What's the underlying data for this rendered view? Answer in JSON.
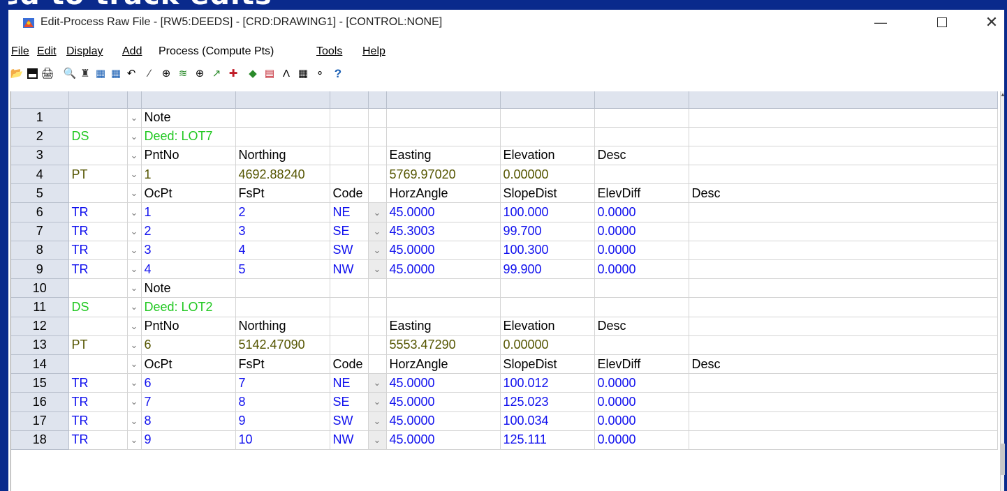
{
  "window": {
    "title": "Edit-Process Raw File - [RW5:DEEDS] - [CRD:DRAWING1] - [CONTROL:NONE]",
    "background_partial_text": "ed to track edits"
  },
  "menu": {
    "file": "File",
    "edit": "Edit",
    "display": "Display",
    "add": "Add",
    "process": "Process (Compute Pts)",
    "tools": "Tools",
    "help": "Help"
  },
  "toolbar": {
    "icons": [
      "open-icon",
      "save-icon",
      "print-icon",
      "find-icon",
      "find-replace-icon",
      "insert-record-icon",
      "delete-record-icon",
      "undo-icon",
      "traverse-icon",
      "zoom-icon",
      "sideshot-icon",
      "locate-icon",
      "pick-icon",
      "point-icon",
      "survey-icon",
      "graph-icon",
      "traverse-adjust-icon",
      "settings-icon",
      "view-icon",
      "help-icon"
    ]
  },
  "colors": {
    "record_type": "#22c822",
    "traverse": "#1010ee",
    "point": "#555500"
  },
  "rows": [
    {
      "num": "1",
      "type": "",
      "c1": "Note",
      "c2": "",
      "c3": "",
      "c4": "",
      "c5": "",
      "c6": "",
      "c7": "",
      "style": "black",
      "dd2": false
    },
    {
      "num": "2",
      "type": "DS",
      "c1": "Deed: LOT7",
      "c2": "",
      "c3": "",
      "c4": "",
      "c5": "",
      "c6": "",
      "c7": "",
      "style": "green",
      "dd2": false
    },
    {
      "num": "3",
      "type": "",
      "c1": "PntNo",
      "c2": "Northing",
      "c3": "",
      "c4": "Easting",
      "c5": "Elevation",
      "c6": "Desc",
      "c7": "",
      "style": "black",
      "dd2": false
    },
    {
      "num": "4",
      "type": "PT",
      "c1": "1",
      "c2": "4692.88240",
      "c3": "",
      "c4": "5769.97020",
      "c5": "0.00000",
      "c6": "",
      "c7": "",
      "style": "olive",
      "dd2": false
    },
    {
      "num": "5",
      "type": "",
      "c1": "OcPt",
      "c2": "FsPt",
      "c3": "Code",
      "c4": "HorzAngle",
      "c5": "SlopeDist",
      "c6": "ElevDiff",
      "c7": "Desc",
      "style": "black",
      "dd2": false
    },
    {
      "num": "6",
      "type": "TR",
      "c1": "1",
      "c2": "2",
      "c3": "NE",
      "c4": "45.0000",
      "c5": "100.000",
      "c6": "0.0000",
      "c7": "",
      "style": "blue",
      "dd2": true
    },
    {
      "num": "7",
      "type": "TR",
      "c1": "2",
      "c2": "3",
      "c3": "SE",
      "c4": "45.3003",
      "c5": "99.700",
      "c6": "0.0000",
      "c7": "",
      "style": "blue",
      "dd2": true
    },
    {
      "num": "8",
      "type": "TR",
      "c1": "3",
      "c2": "4",
      "c3": "SW",
      "c4": "45.0000",
      "c5": "100.300",
      "c6": "0.0000",
      "c7": "",
      "style": "blue",
      "dd2": true
    },
    {
      "num": "9",
      "type": "TR",
      "c1": "4",
      "c2": "5",
      "c3": "NW",
      "c4": "45.0000",
      "c5": "99.900",
      "c6": "0.0000",
      "c7": "",
      "style": "blue",
      "dd2": true
    },
    {
      "num": "10",
      "type": "",
      "c1": "Note",
      "c2": "",
      "c3": "",
      "c4": "",
      "c5": "",
      "c6": "",
      "c7": "",
      "style": "black",
      "dd2": false
    },
    {
      "num": "11",
      "type": "DS",
      "c1": "Deed: LOT2",
      "c2": "",
      "c3": "",
      "c4": "",
      "c5": "",
      "c6": "",
      "c7": "",
      "style": "green",
      "dd2": false
    },
    {
      "num": "12",
      "type": "",
      "c1": "PntNo",
      "c2": "Northing",
      "c3": "",
      "c4": "Easting",
      "c5": "Elevation",
      "c6": "Desc",
      "c7": "",
      "style": "black",
      "dd2": false
    },
    {
      "num": "13",
      "type": "PT",
      "c1": "6",
      "c2": "5142.47090",
      "c3": "",
      "c4": "5553.47290",
      "c5": "0.00000",
      "c6": "",
      "c7": "",
      "style": "olive",
      "dd2": false
    },
    {
      "num": "14",
      "type": "",
      "c1": "OcPt",
      "c2": "FsPt",
      "c3": "Code",
      "c4": "HorzAngle",
      "c5": "SlopeDist",
      "c6": "ElevDiff",
      "c7": "Desc",
      "style": "black",
      "dd2": false
    },
    {
      "num": "15",
      "type": "TR",
      "c1": "6",
      "c2": "7",
      "c3": "NE",
      "c4": "45.0000",
      "c5": "100.012",
      "c6": "0.0000",
      "c7": "",
      "style": "blue",
      "dd2": true
    },
    {
      "num": "16",
      "type": "TR",
      "c1": "7",
      "c2": "8",
      "c3": "SE",
      "c4": "45.0000",
      "c5": "125.023",
      "c6": "0.0000",
      "c7": "",
      "style": "blue",
      "dd2": true
    },
    {
      "num": "17",
      "type": "TR",
      "c1": "8",
      "c2": "9",
      "c3": "SW",
      "c4": "45.0000",
      "c5": "100.034",
      "c6": "0.0000",
      "c7": "",
      "style": "blue",
      "dd2": true
    },
    {
      "num": "18",
      "type": "TR",
      "c1": "9",
      "c2": "10",
      "c3": "NW",
      "c4": "45.0000",
      "c5": "125.111",
      "c6": "0.0000",
      "c7": "",
      "style": "blue",
      "dd2": true
    }
  ]
}
